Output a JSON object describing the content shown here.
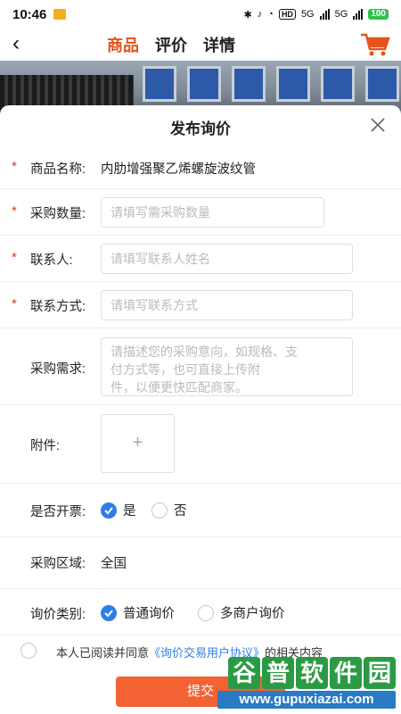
{
  "status_bar": {
    "time": "10:46",
    "net_label": "HD",
    "sig1": "5G",
    "sig2": "5G",
    "battery": "100"
  },
  "nav": {
    "tabs": [
      {
        "label": "商品",
        "active": true
      },
      {
        "label": "评价",
        "active": false
      },
      {
        "label": "详情",
        "active": false
      }
    ],
    "accent_color": "#e5531a"
  },
  "sheet": {
    "title": "发布询价",
    "product": {
      "label": "商品名称:",
      "value": "内肋增强聚乙烯螺旋波纹管"
    },
    "quantity": {
      "label": "采购数量:",
      "placeholder": "请填写需采购数量"
    },
    "contact": {
      "label": "联系人:",
      "placeholder": "请填写联系人姓名"
    },
    "contact_method": {
      "label": "联系方式:",
      "placeholder": "请填写联系方式"
    },
    "requirement": {
      "label": "采购需求:",
      "placeholder_lines": [
        "请描述您的采购意向，如规格、支",
        "付方式等，也可直接上传附",
        "件，以便更快匹配商家。"
      ]
    },
    "attachment": {
      "label": "附件:",
      "plus": "+"
    },
    "invoice": {
      "label": "是否开票:",
      "options": [
        {
          "label": "是",
          "selected": true
        },
        {
          "label": "否",
          "selected": false
        }
      ]
    },
    "region": {
      "label": "采购区域:",
      "value": "全国"
    },
    "inquiry_type": {
      "label": "询价类别:",
      "options": [
        {
          "label": "普通询价",
          "selected": true
        },
        {
          "label": "多商户询价",
          "selected": false
        }
      ]
    },
    "agreement": {
      "prefix": "本人已阅读并同意",
      "link": "《询价交易用户协议》",
      "suffix": "的相关内容"
    },
    "submit_label": "提交",
    "required_mark": "*"
  },
  "watermark": {
    "chars": [
      "谷",
      "普",
      "软",
      "件",
      "园"
    ],
    "url": "www.gupuxiazai.com"
  },
  "colors": {
    "primary_blue": "#2f7ee6",
    "submit_orange": "#f26233",
    "required_red": "#e0381e"
  },
  "icons": [
    "back-arrow-icon",
    "cart-icon",
    "close-icon",
    "plus-icon",
    "check-icon"
  ]
}
